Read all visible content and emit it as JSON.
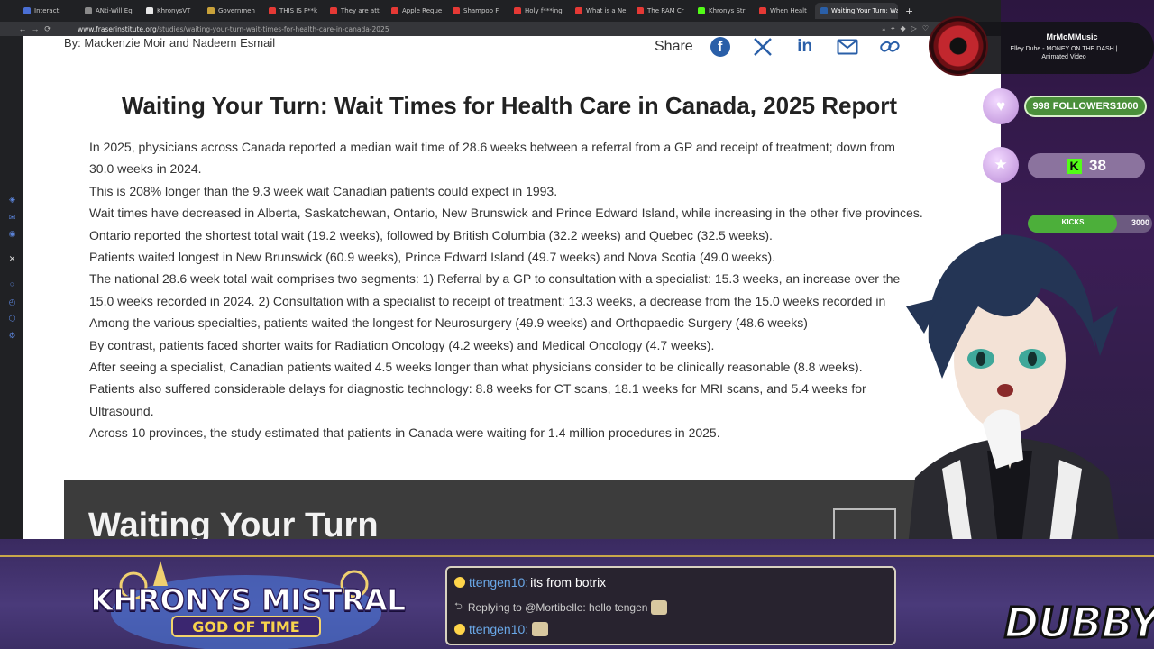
{
  "browser": {
    "tabs": [
      {
        "label": "Interacti",
        "color": "#4a6fd4"
      },
      {
        "label": "ANti-Will Eq",
        "color": "#8a8a8a"
      },
      {
        "label": "KhronysVT",
        "color": "#e8e8e8"
      },
      {
        "label": "Governmen",
        "color": "#c9a23a"
      },
      {
        "label": "THIS IS F**k",
        "color": "#e53935"
      },
      {
        "label": "They are att",
        "color": "#e53935"
      },
      {
        "label": "Apple Reque",
        "color": "#e53935"
      },
      {
        "label": "Shampoo F",
        "color": "#e53935"
      },
      {
        "label": "Holy f***ing",
        "color": "#e53935"
      },
      {
        "label": "What is a Ne",
        "color": "#e53935"
      },
      {
        "label": "The RAM Cr",
        "color": "#e53935"
      },
      {
        "label": "Khronys Str",
        "color": "#53fc18"
      },
      {
        "label": "When Healt",
        "color": "#e53935"
      }
    ],
    "active_tab": {
      "label": "Waiting Your Turn: Wai",
      "favicon": "FI"
    },
    "url_host": "www.fraserinstitute.org",
    "url_path": "/studies/waiting-your-turn-wait-times-for-health-care-in-canada-2025"
  },
  "page": {
    "byline": "By: Mackenzie Moir and Nadeem Esmail",
    "share_label": "Share",
    "share_icons": [
      "facebook-icon",
      "x-icon",
      "linkedin-icon",
      "mail-icon",
      "link-icon"
    ],
    "title": "Waiting Your Turn: Wait Times for Health Care in Canada, 2025 Report",
    "bullets": [
      "In 2025, physicians across Canada reported a median wait time of 28.6 weeks between a referral from a GP and receipt of treatment; down from",
      "30.0 weeks in 2024.",
      "This is 208% longer than the 9.3 week wait Canadian patients could expect in 1993.",
      "Wait times have decreased in Alberta, Saskatchewan, Ontario, New Brunswick and Prince Edward Island, while increasing in the other five provinces.",
      "Ontario reported the shortest total wait (19.2 weeks), followed by British Columbia (32.2 weeks) and Quebec (32.5 weeks).",
      "Patients waited longest in New Brunswick (60.9 weeks), Prince Edward Island (49.7 weeks) and Nova Scotia (49.0 weeks).",
      "The national 28.6 week total wait comprises two segments: 1) Referral by a GP to consultation with a specialist: 15.3 weeks, an increase over the",
      "15.0 weeks recorded in 2024. 2) Consultation with a specialist to receipt of treatment: 13.3 weeks, a decrease from the 15.0 weeks recorded in",
      "Among the various specialties, patients waited the longest for Neurosurgery (49.9 weeks) and Orthopaedic Surgery (48.6 weeks)",
      "By contrast, patients faced shorter waits for Radiation Oncology (4.2 weeks) and Medical Oncology (4.7 weeks).",
      "After seeing a specialist, Canadian patients waited 4.5 weeks longer than what physicians consider to be clinically reasonable (8.8 weeks).",
      "Patients also suffered considerable delays for diagnostic technology: 8.8 weeks for CT scans, 18.1 weeks for MRI scans, and 5.4 weeks for",
      "Ultrasound.",
      "Across 10 provinces, the study estimated that patients in Canada were waiting for 1.4 million procedures in 2025."
    ],
    "bullet_markers": [
      true,
      false,
      true,
      true,
      true,
      true,
      true,
      false,
      true,
      true,
      true,
      true,
      false,
      true
    ],
    "banner_title": "Waiting Your Turn"
  },
  "overlay": {
    "music": {
      "artist": "MrMoMMusic",
      "track": "Elley Duhe - MONEY ON THE DASH | Animated Video"
    },
    "followers": {
      "current": "998",
      "label": "FOLLOWERS",
      "goal": "1000"
    },
    "kick_count": "38",
    "kicks_goal": {
      "label": "KICKS",
      "goal": "3000",
      "progress": 0.72
    },
    "logo_line1": "KHRONYS MISTRAL",
    "logo_line2": "GOD OF TIME",
    "chat": [
      {
        "user": "ttengen10:",
        "message": "its from botrix"
      },
      {
        "reply": "Replying to @Mortibelle: hello tengen"
      },
      {
        "user": "ttengen10:",
        "message": ""
      }
    ],
    "dubby": "DUBBY"
  },
  "colors": {
    "link_blue": "#2a5fa8",
    "kick_green": "#53fc18",
    "follower_green": "#4a8f3a"
  }
}
